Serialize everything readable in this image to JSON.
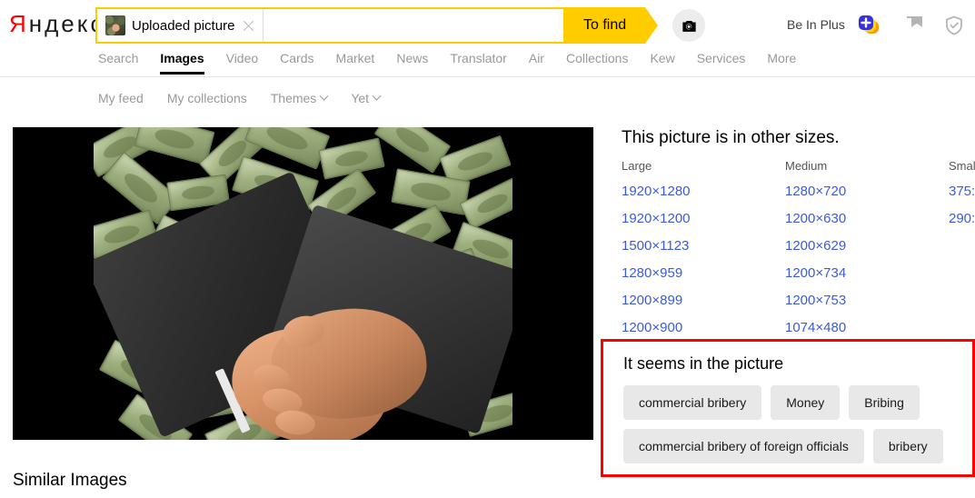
{
  "brand": {
    "logo_first": "Я",
    "logo_rest": "ндекс"
  },
  "search": {
    "chip_label": "Uploaded picture",
    "chip_thumb_icon": "uploaded-image-thumbnail",
    "close_icon": "close-icon",
    "query_value": "",
    "query_placeholder": "",
    "find_label": "To find",
    "camera_icon": "camera-search-icon"
  },
  "account": {
    "plus_label": "Be In Plus",
    "plus_badge_icon": "yandex-plus-badge-icon",
    "flag_icon": "bookmark-flag-icon",
    "shield_icon": "shield-check-icon"
  },
  "nav": {
    "items": [
      {
        "label": "Search",
        "active": false
      },
      {
        "label": "Images",
        "active": true
      },
      {
        "label": "Video",
        "active": false
      },
      {
        "label": "Cards",
        "active": false
      },
      {
        "label": "Market",
        "active": false
      },
      {
        "label": "News",
        "active": false
      },
      {
        "label": "Translator",
        "active": false
      },
      {
        "label": "Air",
        "active": false
      },
      {
        "label": "Collections",
        "active": false
      },
      {
        "label": "Kew",
        "active": false
      },
      {
        "label": "Services",
        "active": false
      },
      {
        "label": "More",
        "active": false
      }
    ]
  },
  "subnav": {
    "items": [
      {
        "label": "My feed",
        "caret": false
      },
      {
        "label": "My collections",
        "caret": false
      },
      {
        "label": "Themes",
        "caret": true
      },
      {
        "label": "Yet",
        "caret": true
      }
    ]
  },
  "photo": {
    "alt": "handshake-over-falling-dollar-bills"
  },
  "sizes": {
    "heading": "This picture is in other sizes.",
    "columns": [
      {
        "title": "Large",
        "links": [
          "1920×1280",
          "1920×1200",
          "1500×1123",
          "1280×959",
          "1200×899",
          "1200×900"
        ]
      },
      {
        "title": "Medium",
        "links": [
          "1280×720",
          "1200×630",
          "1200×629",
          "1200×734",
          "1200×753",
          "1074×480"
        ]
      },
      {
        "title": "Smal",
        "links": [
          "375:",
          "290:"
        ]
      }
    ]
  },
  "seems": {
    "title": "It seems in the picture",
    "highlight_color": "#ff0000",
    "tags": [
      "commercial bribery",
      "Money",
      "Bribing",
      "commercial bribery of foreign officials",
      "bribery"
    ]
  },
  "similar": {
    "heading": "Similar Images"
  }
}
